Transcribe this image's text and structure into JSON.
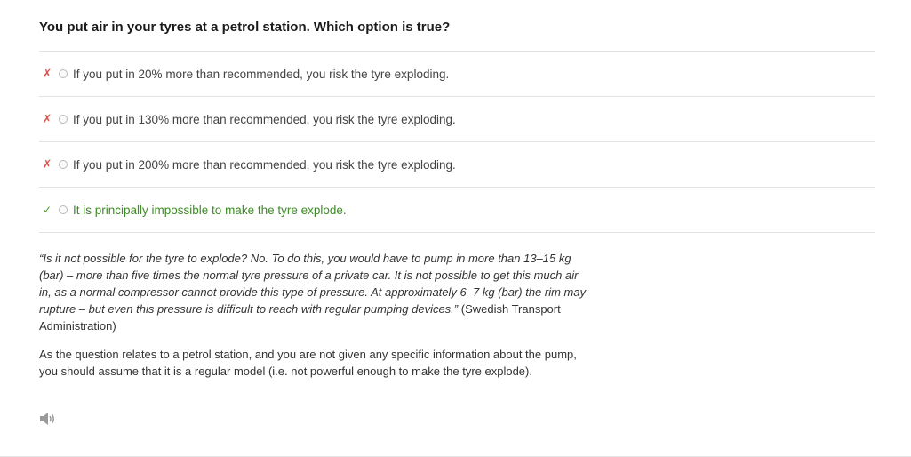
{
  "question": {
    "text": "You put air in your tyres at a petrol station. Which option is true?"
  },
  "options": [
    {
      "mark": "✗",
      "status": "incorrect",
      "text": "If you put in 20% more than recommended, you risk the tyre exploding."
    },
    {
      "mark": "✗",
      "status": "incorrect",
      "text": "If you put in 130% more than recommended, you risk the tyre exploding."
    },
    {
      "mark": "✗",
      "status": "incorrect",
      "text": "If you put in 200% more than recommended, you risk the tyre exploding."
    },
    {
      "mark": "✓",
      "status": "correct",
      "text": "It is principally impossible to make the tyre explode."
    }
  ],
  "explanation": {
    "quote_text": "“Is it not possible for the tyre to explode? No. To do this, you would have to pump in more than 13–15 kg (bar) – more than five times the normal tyre pressure of a private car. It is not possible to get this much air in, as a normal compressor cannot provide this type of pressure. At approximately 6–7 kg (bar) the rim may rupture – but even this pressure is difficult to reach with regular pumping devices.”",
    "quote_source": " (Swedish Transport Administration)",
    "paragraph": "As the question relates to a petrol station, and you are not given any specific information about the pump, you should assume that it is a regular model (i.e. not powerful enough to make the tyre explode)."
  },
  "audio": {
    "icon": "speaker-icon"
  },
  "colors": {
    "incorrect": "#d9534f",
    "correct": "#3d8c25",
    "divider": "#e3e3e3"
  }
}
